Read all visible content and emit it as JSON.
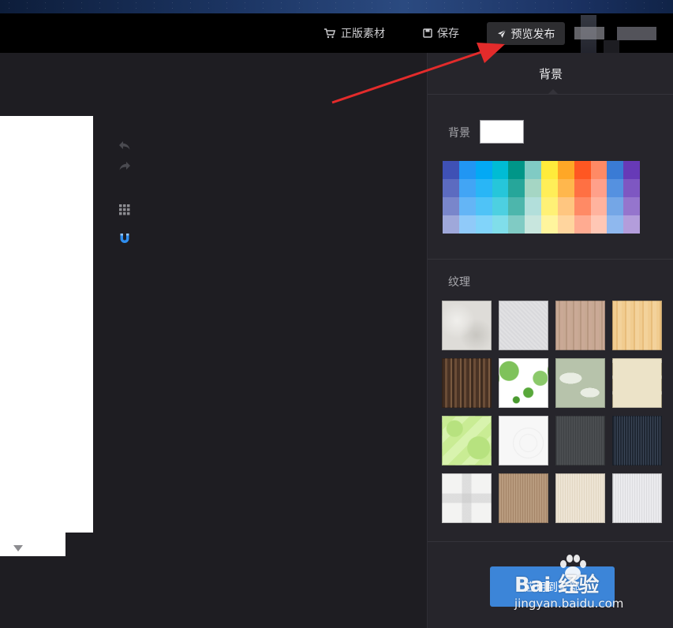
{
  "toolbar": {
    "stock_label": "正版素材",
    "save_label": "保存",
    "publish_label": "预览发布"
  },
  "panel": {
    "title": "背景",
    "bg_label": "背景",
    "bg_color": "#ffffff",
    "texture_label": "纹理",
    "apply_label": "应用到全部"
  },
  "palette": [
    [
      "#3f51b5",
      "#2196f3",
      "#03a9f4",
      "#00bcd4",
      "#009688",
      "#80cbc4",
      "#ffeb3b",
      "#ffa726",
      "#ff5722",
      "#ff8a65",
      "#3a7bd5",
      "#673ab7"
    ],
    [
      "#5c6bc0",
      "#42a5f5",
      "#29b6f6",
      "#26c6da",
      "#26a69a",
      "#a5d6c4",
      "#ffee58",
      "#ffb74d",
      "#ff7043",
      "#ffa08a",
      "#5591e0",
      "#7e57c2"
    ],
    [
      "#7986cb",
      "#64b5f6",
      "#4fc3f7",
      "#4dd0e1",
      "#4db6ac",
      "#b2dfdb",
      "#fff176",
      "#ffc680",
      "#ff8a65",
      "#ffb39e",
      "#74a6e6",
      "#9575cd"
    ],
    [
      "#9fa8da",
      "#90caf9",
      "#81d4fa",
      "#80deea",
      "#80cbc4",
      "#c8e6de",
      "#fff59d",
      "#ffd59e",
      "#ffab91",
      "#ffc7b5",
      "#8fb8ee",
      "#b39ddb"
    ]
  ],
  "textures": [
    "light-stone",
    "light-gray-paper",
    "beige-wood",
    "light-wood",
    "dark-wood",
    "green-dots",
    "sage-leaves",
    "beige-bricks",
    "green-circles",
    "white-swirl",
    "dark-linen",
    "dark-knit",
    "white-plaid",
    "burlap",
    "cream-canvas",
    "light-linen"
  ],
  "watermark": {
    "brand": "Bai 经验",
    "url": "jingyan.baidu.com"
  }
}
